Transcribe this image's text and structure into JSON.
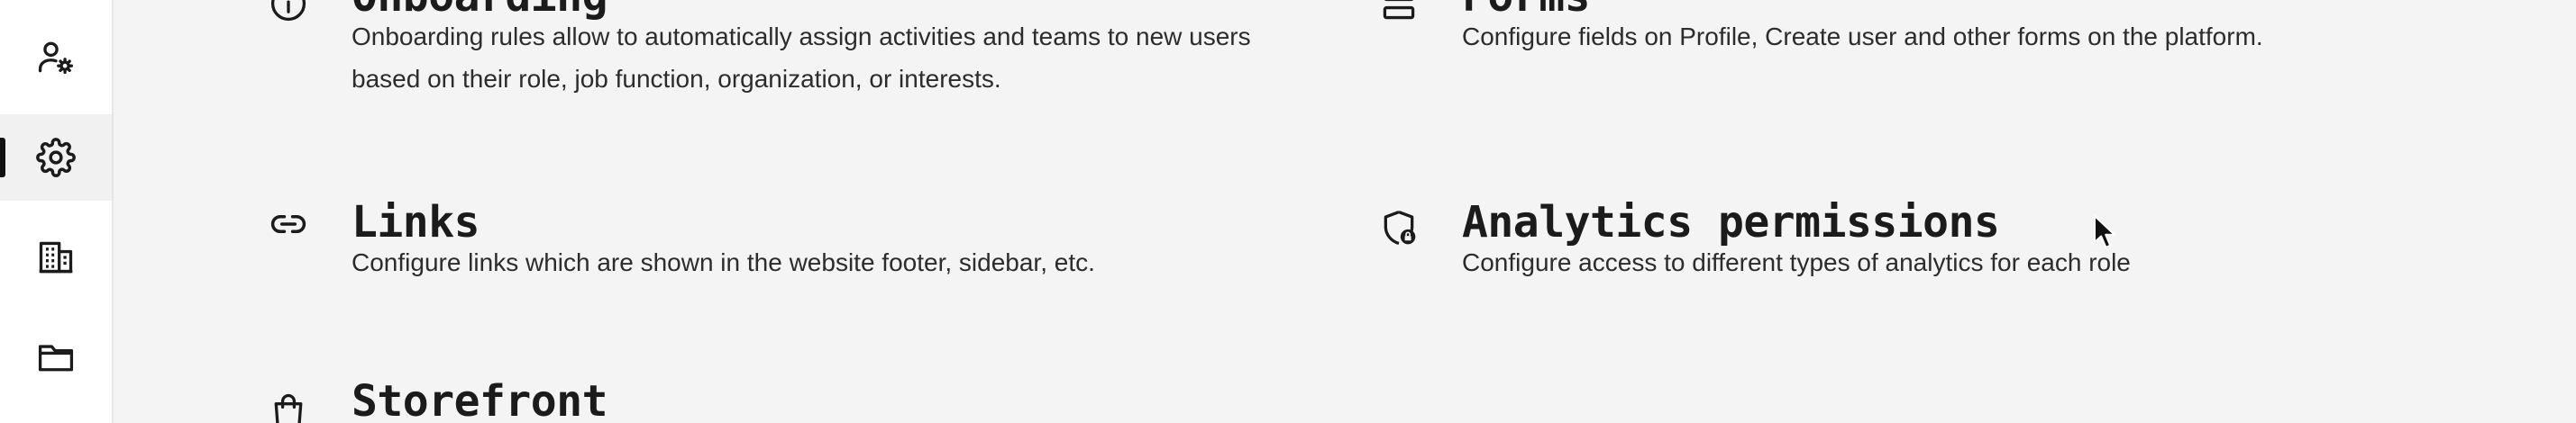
{
  "sidebar": {
    "items": [
      {
        "icon": "user-settings-icon",
        "active": false
      },
      {
        "icon": "gear-icon",
        "active": true
      },
      {
        "icon": "building-icon",
        "active": false
      },
      {
        "icon": "folder-icon",
        "active": false
      }
    ]
  },
  "settings": {
    "onboarding": {
      "icon": "info-icon",
      "title": "Onboarding",
      "desc_line1": "Onboarding rules allow to automatically assign activities and teams to new users",
      "desc_line2": "based on their role, job function, organization, or interests."
    },
    "forms": {
      "icon": "form-rows-icon",
      "title": "Forms",
      "desc": "Configure fields on Profile, Create user and other forms on the platform."
    },
    "links": {
      "icon": "link-icon",
      "title": "Links",
      "desc": "Configure links which are shown in the website footer, sidebar, etc."
    },
    "analytics_permissions": {
      "icon": "shield-lock-icon",
      "title": "Analytics permissions",
      "desc": "Configure access to different types of analytics for each role"
    },
    "storefront": {
      "icon": "shopping-bag-icon",
      "title": "Storefront"
    }
  },
  "colors": {
    "background": "#f4f4f4",
    "sidebar": "#ffffff",
    "active_indicator": "#111111",
    "text": "#1f1f1f"
  }
}
